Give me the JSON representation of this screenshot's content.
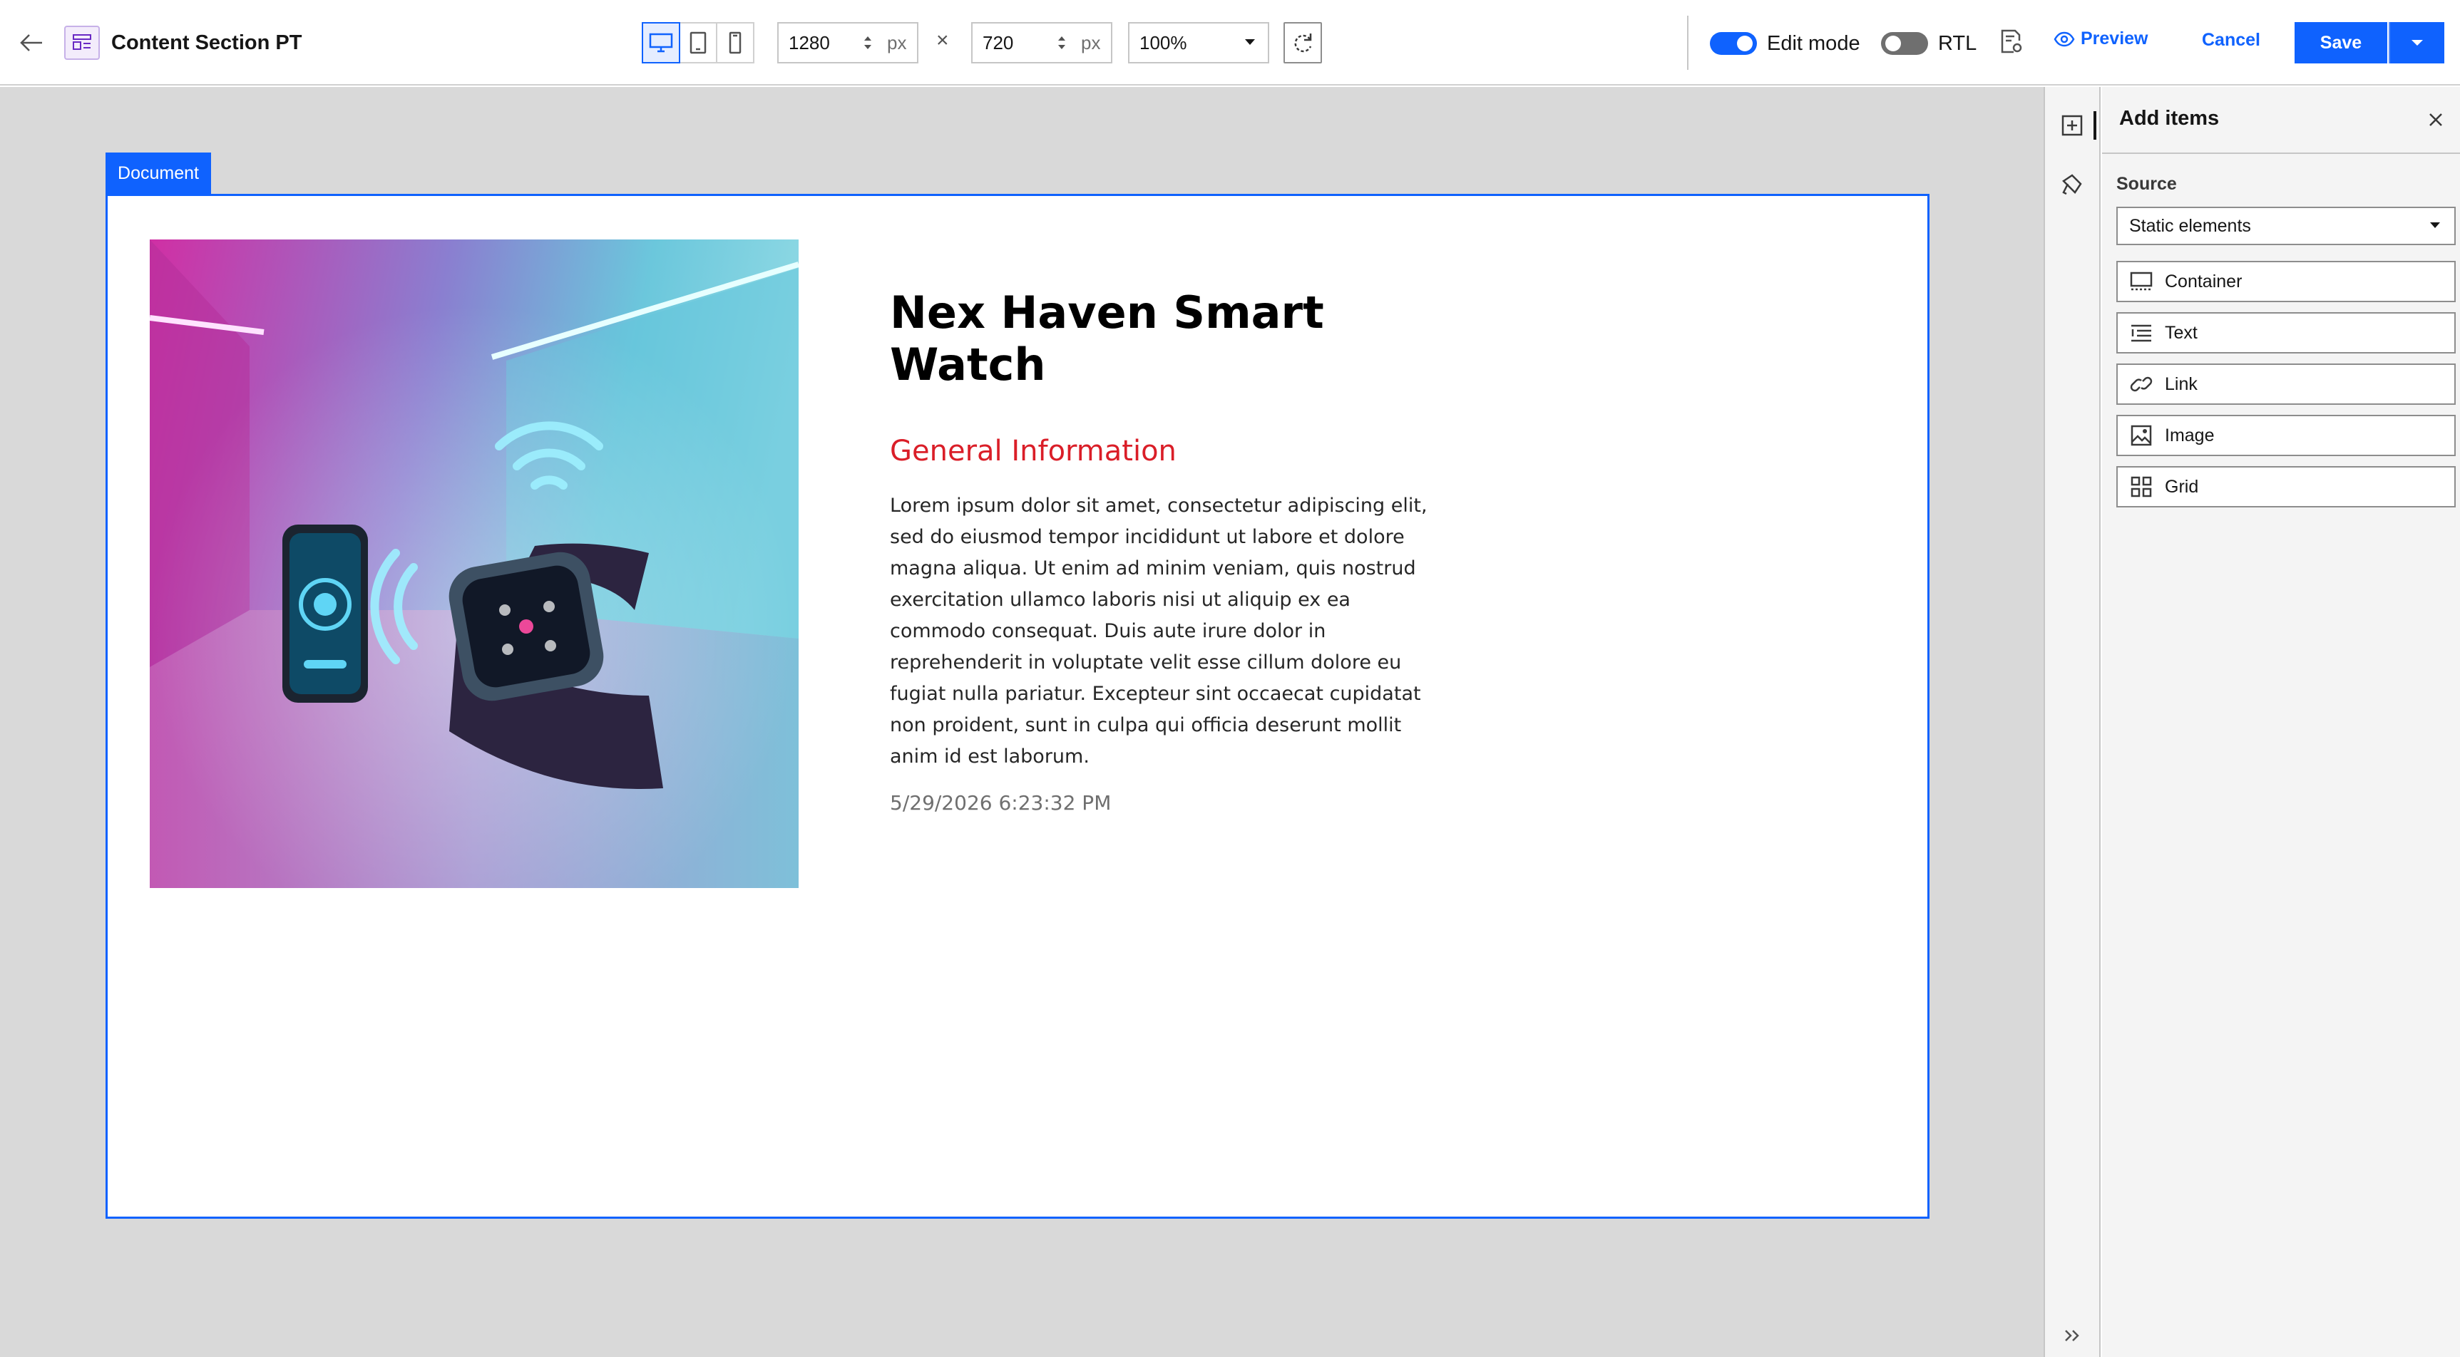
{
  "header": {
    "title": "Content Section PT",
    "width_value": "1280",
    "height_value": "720",
    "unit": "px",
    "times": "×",
    "zoom": "100%",
    "edit_mode_label": "Edit mode",
    "edit_mode_on": true,
    "rtl_label": "RTL",
    "rtl_on": false,
    "preview_label": "Preview",
    "cancel_label": "Cancel",
    "save_label": "Save",
    "accent_color": "#0f62fe"
  },
  "canvas": {
    "document_tag": "Document",
    "product_title": "Nex Haven Smart Watch",
    "section_heading": "General Information",
    "body": "Lorem ipsum dolor sit amet, consectetur adipiscing elit, sed do eiusmod tempor incididunt ut labore et dolore magna aliqua. Ut enim ad minim veniam, quis nostrud exercitation ullamco laboris nisi ut aliquip ex ea commodo consequat. Duis aute irure dolor in reprehenderit in voluptate velit esse cillum dolore eu fugiat nulla pariatur. Excepteur sint occaecat cupidatat non proident, sunt in culpa qui officia deserunt mollit anim id est laborum.",
    "timestamp": "5/29/2026 6:23:32 PM",
    "heading_color": "#da1e28"
  },
  "panel": {
    "title": "Add items",
    "source_label": "Source",
    "source_value": "Static elements",
    "items": [
      {
        "label": "Container",
        "icon": "container-icon"
      },
      {
        "label": "Text",
        "icon": "text-icon"
      },
      {
        "label": "Link",
        "icon": "link-icon"
      },
      {
        "label": "Image",
        "icon": "image-icon"
      },
      {
        "label": "Grid",
        "icon": "grid-icon"
      }
    ]
  }
}
